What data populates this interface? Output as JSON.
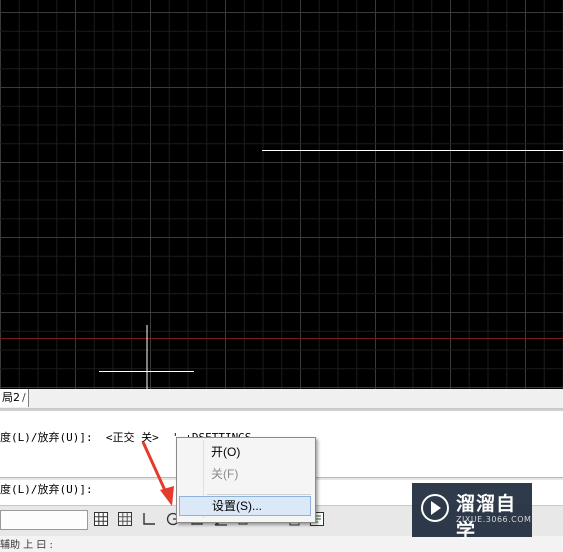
{
  "layout_tab": {
    "label": "局2",
    "separator": "/"
  },
  "command_history": [
    {
      "text": "度(L)/放弃(U)]:  <正交 关>  '_+DSETTINGS"
    },
    {
      "text": "度(L)/放弃(U)]:"
    }
  ],
  "context_menu": {
    "items": [
      {
        "label": "开(O)",
        "enabled": true
      },
      {
        "label": "关(F)",
        "enabled": false
      },
      {
        "label": "设置(S)...",
        "enabled": true,
        "highlighted": true
      }
    ]
  },
  "status_bar": {
    "buttons": [
      "grid-display-icon",
      "snap-mode-icon",
      "ortho-mode-icon",
      "polar-tracking-icon",
      "object-snap-icon",
      "dynamic-ucs-icon",
      "object-snap-tracking-icon",
      "lineweight-icon",
      "transparency-icon",
      "quick-properties-icon"
    ]
  },
  "bottom_strip": {
    "text": "辅助 上 曰 :"
  },
  "watermark": {
    "title": "溜溜自学",
    "subtitle": "ZIXUE.3066.COM"
  },
  "colors": {
    "canvas": "#000000",
    "grid_minor": "#1c1c1c",
    "grid_major": "#3a3a3a",
    "crosshair": "#ffffff",
    "red_axis": "#7a1a1a",
    "arrow": "#e53b2c"
  }
}
